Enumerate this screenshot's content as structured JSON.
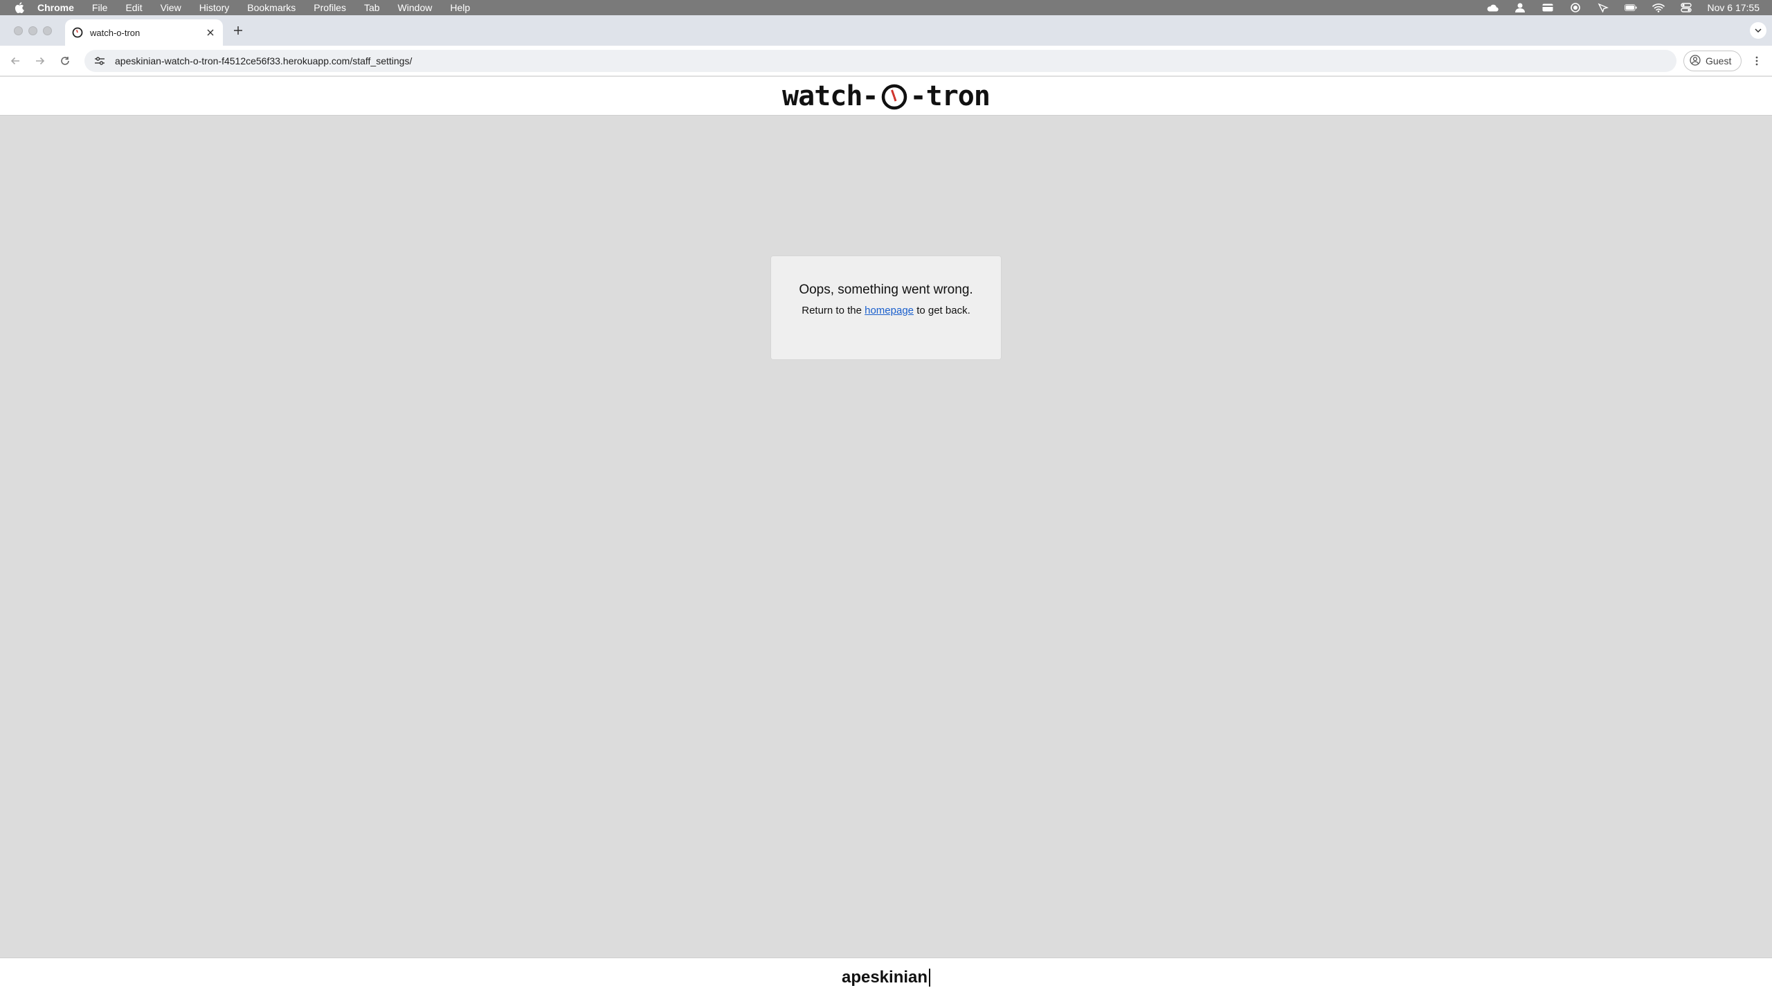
{
  "menubar": {
    "app_name": "Chrome",
    "items": [
      "File",
      "Edit",
      "View",
      "History",
      "Bookmarks",
      "Profiles",
      "Tab",
      "Window",
      "Help"
    ],
    "clock": "Nov 6  17:55",
    "status_icons": [
      "cloud-icon",
      "user-icon",
      "card-icon",
      "record-icon",
      "cast-icon",
      "battery-icon",
      "wifi-icon",
      "control-center-icon"
    ]
  },
  "tab": {
    "title": "watch-o-tron"
  },
  "toolbar": {
    "url": "apeskinian-watch-o-tron-f4512ce56f33.herokuapp.com/staff_settings/",
    "profile_label": "Guest"
  },
  "site": {
    "logo_left": "watch-",
    "logo_right": "-tron",
    "accent_color": "#d0342c"
  },
  "error": {
    "title": "Oops, something went wrong.",
    "text_before": "Return to the ",
    "link_label": "homepage",
    "text_after": " to get back."
  },
  "footer": {
    "username": "apeskinian"
  }
}
